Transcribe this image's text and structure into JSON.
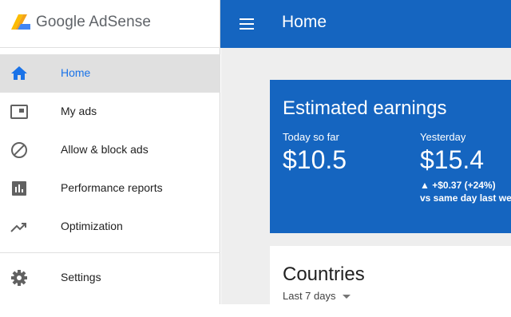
{
  "app": {
    "brand_name": "Google AdSense",
    "page_title": "Home"
  },
  "sidebar": {
    "items": [
      {
        "label": "Home",
        "icon": "home-icon",
        "active": true
      },
      {
        "label": "My ads",
        "icon": "ad-unit-icon"
      },
      {
        "label": "Allow & block ads",
        "icon": "block-icon"
      },
      {
        "label": "Performance reports",
        "icon": "bar-chart-icon"
      },
      {
        "label": "Optimization",
        "icon": "trending-up-icon"
      },
      {
        "label": "Settings",
        "icon": "gear-icon"
      }
    ]
  },
  "earnings": {
    "title": "Estimated earnings",
    "today_label": "Today so far",
    "today_value": "$10.5",
    "yesterday_label": "Yesterday",
    "yesterday_value": "$15.4",
    "change": "▲ +$0.37 (+24%)",
    "compare_text": "vs same day last week"
  },
  "countries": {
    "title": "Countries",
    "range": "Last 7 days"
  },
  "colors": {
    "primary": "#1565c0",
    "active_text": "#1a73e8",
    "active_bg": "#e0e0e0",
    "background": "#eeeeee"
  }
}
